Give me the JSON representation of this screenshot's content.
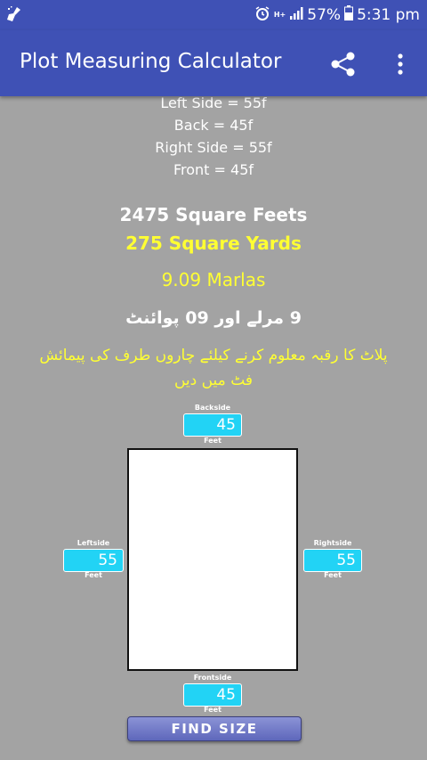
{
  "status_bar": {
    "network_label": "H+",
    "battery": "57%",
    "time": "5:31 pm"
  },
  "app_bar": {
    "title": "Plot Measuring Calculator"
  },
  "sides": {
    "left": "Left Side = 55f",
    "back": "Back = 45f",
    "right": "Right Side = 55f",
    "front": "Front = 45f"
  },
  "results": {
    "square_feet": "2475 Square Feets",
    "square_yards": "275 Square Yards",
    "marlas": "9.09 Marlas",
    "urdu_marla": "9 مرلے اور 09 پوائنٹ",
    "instruction": "پلاٹ کا رقبہ معلوم کرنے کیلئے چاروں طرف کی پیمائش فٹ میں دیں"
  },
  "fields": {
    "back": {
      "label": "Backside",
      "value": "45",
      "unit": "Feet"
    },
    "left": {
      "label": "Leftside",
      "value": "55",
      "unit": "Feet"
    },
    "right": {
      "label": "Rightside",
      "value": "55",
      "unit": "Feet"
    },
    "front": {
      "label": "Frontside",
      "value": "45",
      "unit": "Feet"
    }
  },
  "find_button": "FIND SIZE",
  "colors": {
    "primary": "#3f51b5",
    "background": "#a3a3a3",
    "highlight": "#ffff33",
    "field": "#22d3f5"
  }
}
